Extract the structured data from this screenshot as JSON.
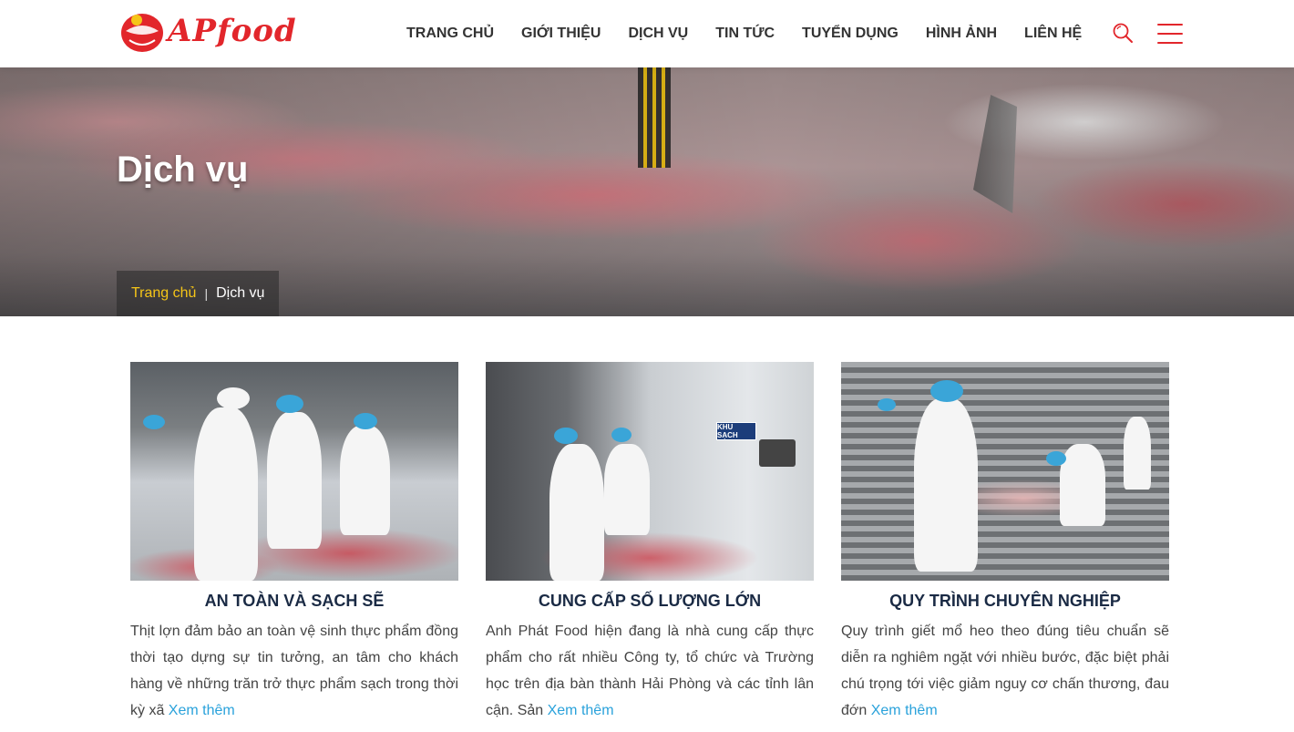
{
  "header": {
    "logo_text": "APfood",
    "nav": [
      "TRANG CHỦ",
      "GIỚI THIỆU",
      "DỊCH VỤ",
      "TIN TỨC",
      "TUYỂN DỤNG",
      "HÌNH ẢNH",
      "LIÊN HỆ"
    ],
    "search_icon": "search-icon",
    "menu_icon": "hamburger-menu-icon"
  },
  "banner": {
    "title": "Dịch vụ",
    "breadcrumb": {
      "home": "Trang chủ",
      "separator": "|",
      "current": "Dịch vụ"
    }
  },
  "services": [
    {
      "title": "AN TOÀN VÀ SẠCH SẼ",
      "description": "Thịt lợn đảm bảo an toàn vệ sinh thực phẩm đồng thời tạo dựng sự tin tưởng, an tâm cho khách hàng về những trăn trở thực phẩm sạch trong thời kỳ xã ",
      "more": "Xem thêm"
    },
    {
      "title": "CUNG CẤP SỐ LƯỢNG LỚN",
      "description": "Anh Phát Food hiện đang là nhà cung cấp thực phẩm cho rất nhiều Công ty, tổ chức và Trường học trên địa bàn thành Hải Phòng và các tỉnh lân cận. Sản ",
      "more": "Xem thêm",
      "sign_text": "KHU SẠCH"
    },
    {
      "title": "QUY TRÌNH CHUYÊN NGHIỆP",
      "description": "Quy trình giết mổ heo theo đúng tiêu chuẩn sẽ diễn ra nghiêm ngặt với nhiều bước, đặc biệt phải chú trọng tới việc giảm nguy cơ chấn thương, đau đớn ",
      "more": "Xem thêm"
    }
  ],
  "colors": {
    "brand_red": "#e2262b",
    "breadcrumb_home": "#f5c518",
    "link": "#2aa2db",
    "title_dark": "#1a2a44"
  }
}
